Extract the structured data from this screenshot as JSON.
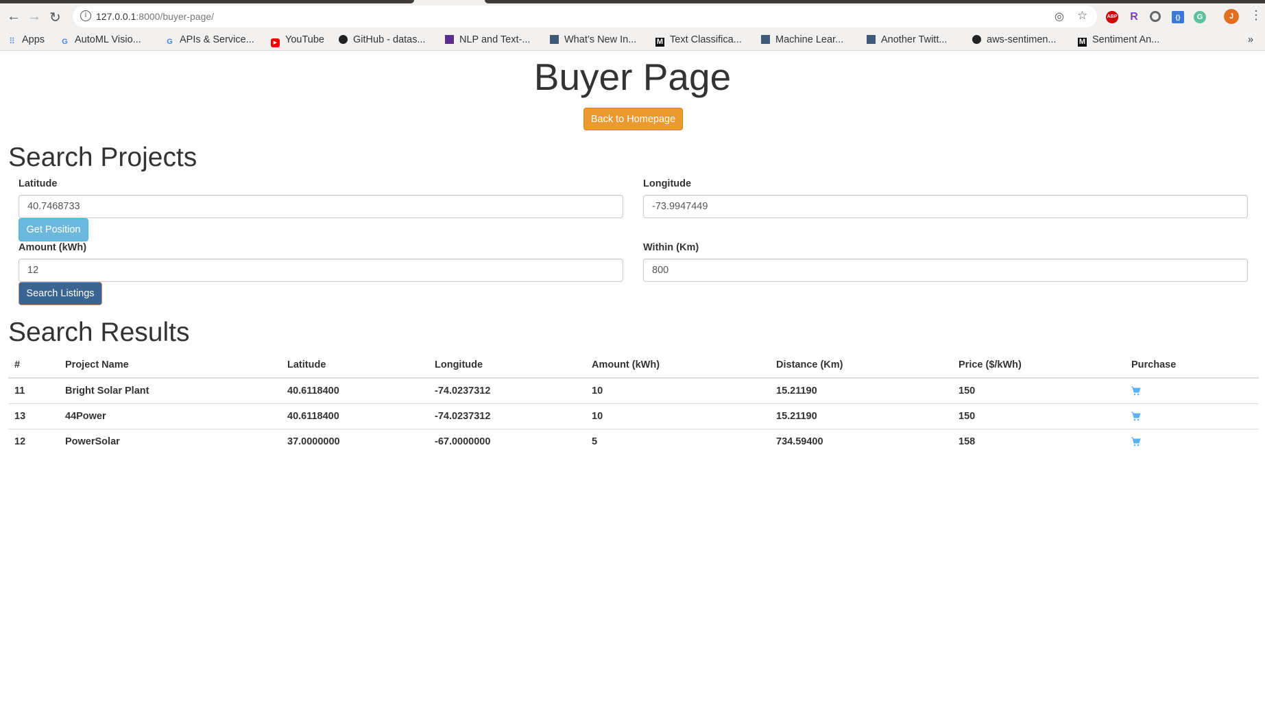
{
  "browser": {
    "url_host": "127.0.0.1",
    "url_rest": ":8000/buyer-page/",
    "bookmarks": [
      {
        "label": "Apps",
        "icon": "apps-grid-icon"
      },
      {
        "label": "AutoML Visio...",
        "icon": "google-icon"
      },
      {
        "label": "APIs & Service...",
        "icon": "google-icon"
      },
      {
        "label": "YouTube",
        "icon": "youtube-icon"
      },
      {
        "label": "GitHub - datas...",
        "icon": "github-icon"
      },
      {
        "label": "NLP and Text-...",
        "icon": "bookmark-icon"
      },
      {
        "label": "What’s New In...",
        "icon": "page-icon"
      },
      {
        "label": "Text Classifica...",
        "icon": "medium-icon"
      },
      {
        "label": "Machine Lear...",
        "icon": "page-icon"
      },
      {
        "label": "Another Twitt...",
        "icon": "page-icon"
      },
      {
        "label": "aws-sentimen...",
        "icon": "github-icon"
      },
      {
        "label": "Sentiment An...",
        "icon": "medium-icon"
      }
    ],
    "more": "»",
    "profile_initial": "J",
    "ext_abp": "ABP"
  },
  "page": {
    "title": "Buyer Page",
    "back_button": "Back to Homepage",
    "search_heading": "Search Projects",
    "fields": {
      "latitude": {
        "label": "Latitude",
        "value": "40.7468733"
      },
      "longitude": {
        "label": "Longitude",
        "value": "-73.9947449"
      },
      "amount": {
        "label": "Amount (kWh)",
        "value": "12"
      },
      "within": {
        "label": "Within (Km)",
        "value": "800"
      }
    },
    "get_position_button": "Get Position",
    "search_button": "Search Listings",
    "results_heading": "Search Results"
  },
  "colors": {
    "warning": "#eb9a30",
    "info": "#6bb8dc",
    "primary": "#3a6491",
    "cart": "#5bb2f0"
  },
  "table": {
    "headers": [
      "#",
      "Project Name",
      "Latitude",
      "Longitude",
      "Amount (kWh)",
      "Distance (Km)",
      "Price ($/kWh)",
      "Purchase"
    ],
    "rows": [
      [
        "11",
        "Bright Solar Plant",
        "40.6118400",
        "-74.0237312",
        "10",
        "15.21190",
        "150"
      ],
      [
        "13",
        "44Power",
        "40.6118400",
        "-74.0237312",
        "10",
        "15.21190",
        "150"
      ],
      [
        "12",
        "PowerSolar",
        "37.0000000",
        "-67.0000000",
        "5",
        "734.59400",
        "158"
      ]
    ]
  }
}
